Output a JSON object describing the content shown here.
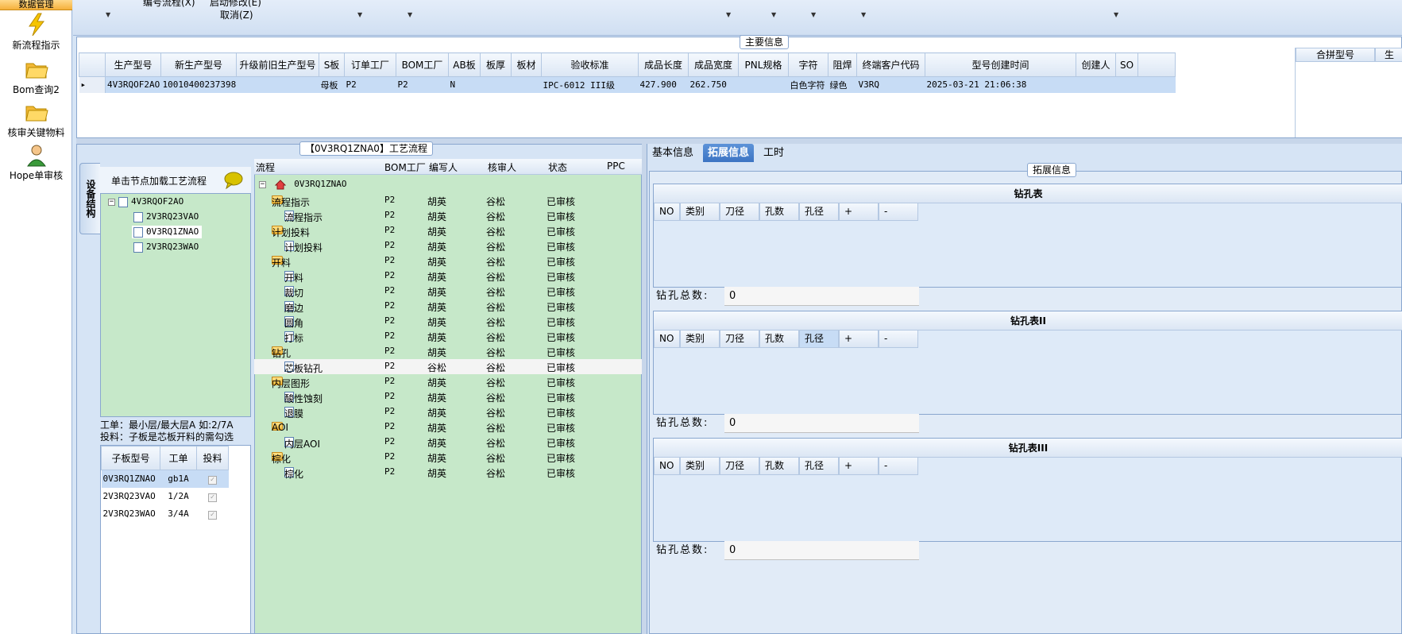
{
  "left_toolbar": {
    "active_item": "数据管理",
    "items": [
      {
        "label": "新流程指示",
        "icon": "lightning-icon"
      },
      {
        "label": "Bom查询2",
        "icon": "folder-open-icon"
      },
      {
        "label": "核审关键物料",
        "icon": "folder-open-icon"
      },
      {
        "label": "Hope单审核",
        "icon": "user-icon"
      }
    ]
  },
  "top_strip": {
    "menu1": "编号流程(X)",
    "menu2": "启动修改(E)",
    "menu3": "取消(Z)"
  },
  "main_info": {
    "title": "主要信息",
    "columns": [
      "生产型号",
      "新生产型号",
      "升级前旧生产型号",
      "S板",
      "订单工厂",
      "BOM工厂",
      "AB板",
      "板厚",
      "板材",
      "验收标准",
      "成品长度",
      "成品宽度",
      "PNL规格",
      "字符",
      "阻焊",
      "终端客户代码",
      "型号创建时间",
      "创建人",
      "SO"
    ],
    "row": [
      "4V3RQOF2AO",
      "10010400237398",
      "",
      "母板",
      "P2",
      "P2",
      "N",
      "",
      "",
      "IPC-6012 III级",
      "427.900",
      "262.750",
      "",
      "白色字符",
      "绿色",
      "V3RQ",
      "2025-03-21 21:06:38",
      "",
      ""
    ],
    "side_columns": [
      "合拼型号",
      "生"
    ]
  },
  "process_flow": {
    "title": "【0V3RQ1ZNA0】工艺流程",
    "vertical_tab": "设备结构",
    "hint": "单击节点加载工艺流程",
    "tree_root": "4V3RQOF2AO",
    "tree_children": [
      "2V3RQ23VAO",
      "0V3RQ1ZNAO",
      "2V3RQ23WAO"
    ],
    "note_line1": "工单：最小层/最大层A 如:2/7A",
    "note_line2": "投料：子板是芯板开料的需勾选",
    "sub_columns": [
      "子板型号",
      "工单",
      "投料"
    ],
    "sub_rows": [
      {
        "model": "0V3RQ1ZNAO",
        "order": "gb1A"
      },
      {
        "model": "2V3RQ23VAO",
        "order": "1/2A"
      },
      {
        "model": "2V3RQ23WAO",
        "order": "3/4A"
      }
    ],
    "flow_columns": [
      "流程",
      "BOM工厂",
      "编写人",
      "核审人",
      "状态",
      "PPC"
    ],
    "flow_root": "0V3RQ1ZNAO",
    "flow_rows": [
      {
        "name": "流程指示",
        "bom": "P2",
        "writer": "胡英",
        "reviewer": "谷松",
        "status": "已审核",
        "level": 1
      },
      {
        "name": "流程指示",
        "bom": "P2",
        "writer": "胡英",
        "reviewer": "谷松",
        "status": "已审核",
        "level": 2
      },
      {
        "name": "计划投料",
        "bom": "P2",
        "writer": "胡英",
        "reviewer": "谷松",
        "status": "已审核",
        "level": 1
      },
      {
        "name": "计划投料",
        "bom": "P2",
        "writer": "胡英",
        "reviewer": "谷松",
        "status": "已审核",
        "level": 2
      },
      {
        "name": "开料",
        "bom": "P2",
        "writer": "胡英",
        "reviewer": "谷松",
        "status": "已审核",
        "level": 1
      },
      {
        "name": "开料",
        "bom": "P2",
        "writer": "胡英",
        "reviewer": "谷松",
        "status": "已审核",
        "level": 2
      },
      {
        "name": "裁切",
        "bom": "P2",
        "writer": "胡英",
        "reviewer": "谷松",
        "status": "已审核",
        "level": 2
      },
      {
        "name": "磨边",
        "bom": "P2",
        "writer": "胡英",
        "reviewer": "谷松",
        "status": "已审核",
        "level": 2
      },
      {
        "name": "圆角",
        "bom": "P2",
        "writer": "胡英",
        "reviewer": "谷松",
        "status": "已审核",
        "level": 2
      },
      {
        "name": "打标",
        "bom": "P2",
        "writer": "胡英",
        "reviewer": "谷松",
        "status": "已审核",
        "level": 2
      },
      {
        "name": "钻孔",
        "bom": "P2",
        "writer": "胡英",
        "reviewer": "谷松",
        "status": "已审核",
        "level": 1
      },
      {
        "name": "芯板钻孔",
        "bom": "P2",
        "writer": "谷松",
        "reviewer": "谷松",
        "status": "已审核",
        "level": 2
      },
      {
        "name": "内层图形",
        "bom": "P2",
        "writer": "胡英",
        "reviewer": "谷松",
        "status": "已审核",
        "level": 1
      },
      {
        "name": "酸性蚀刻",
        "bom": "P2",
        "writer": "胡英",
        "reviewer": "谷松",
        "status": "已审核",
        "level": 2
      },
      {
        "name": "退膜",
        "bom": "P2",
        "writer": "胡英",
        "reviewer": "谷松",
        "status": "已审核",
        "level": 2
      },
      {
        "name": "AOI",
        "bom": "P2",
        "writer": "胡英",
        "reviewer": "谷松",
        "status": "已审核",
        "level": 1
      },
      {
        "name": "内层AOI",
        "bom": "P2",
        "writer": "胡英",
        "reviewer": "谷松",
        "status": "已审核",
        "level": 2
      },
      {
        "name": "棕化",
        "bom": "P2",
        "writer": "胡英",
        "reviewer": "谷松",
        "status": "已审核",
        "level": 1
      },
      {
        "name": "棕化",
        "bom": "P2",
        "writer": "胡英",
        "reviewer": "谷松",
        "status": "已审核",
        "level": 2
      }
    ]
  },
  "right_panel": {
    "tabs": [
      "基本信息",
      "拓展信息",
      "工时"
    ],
    "active_tab": "拓展信息",
    "group_title": "拓展信息",
    "drill_columns": [
      "NO",
      "类别",
      "刀径",
      "孔数",
      "孔径",
      "+",
      "-"
    ],
    "drill_tables": [
      {
        "title": "钻孔表",
        "total_label": "钻孔总数:",
        "total": "0"
      },
      {
        "title": "钻孔表II",
        "total_label": "钻孔总数:",
        "total": "0"
      },
      {
        "title": "钻孔表III",
        "total_label": "钻孔总数:",
        "total": "0"
      }
    ]
  }
}
